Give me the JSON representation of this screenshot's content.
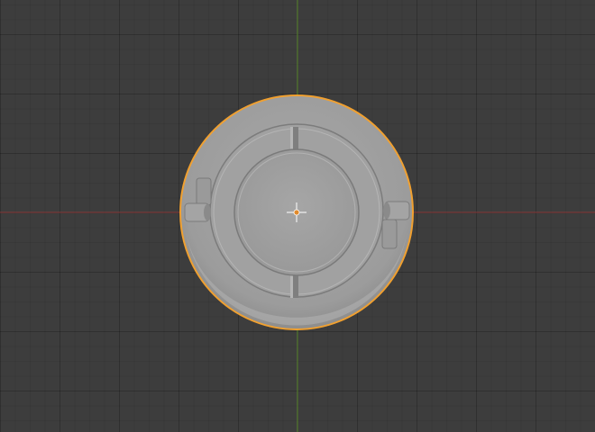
{
  "viewport": {
    "background_color": "#3d3d3d",
    "grid_color": "#363636",
    "axis_x_color": "#8b3a3a",
    "axis_y_color": "#5b8a2e"
  },
  "object": {
    "selected": true,
    "selection_outline_color": "#f0a030",
    "base_color": "#9e9e9e",
    "shade_light": "#b4b4b4",
    "shade_dark": "#6e6e6e"
  },
  "icons": {
    "origin": "object-origin-icon",
    "cursor": "3d-cursor-icon"
  }
}
